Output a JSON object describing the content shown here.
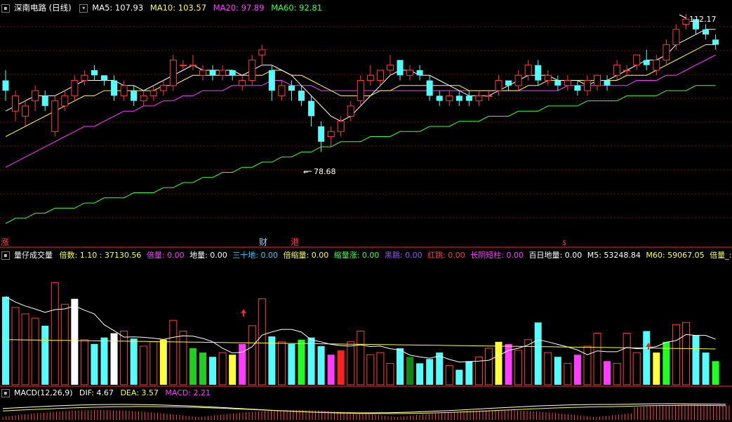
{
  "header": {
    "title": "深南电路 (日线)",
    "ma": [
      {
        "label": "MA5: 107.93",
        "color": "#ffffff"
      },
      {
        "label": "MA10: 103.57",
        "color": "#ffff3c"
      },
      {
        "label": "MA20: 97.89",
        "color": "#ff3cff"
      },
      {
        "label": "MA60: 92.81",
        "color": "#3cff3c"
      }
    ]
  },
  "markers": {
    "zhang": "涨",
    "cai": "财",
    "gang": "港",
    "high_label": "112.17",
    "low_label": "78.68"
  },
  "vol_header": {
    "title": "量仔成交量",
    "items": [
      {
        "label": "倍数: 1.10 : 37130.56",
        "color": "#ffff3c"
      },
      {
        "label": "倍量: 0.00",
        "color": "#ff3cff"
      },
      {
        "label": "地量: 0.00",
        "color": "#ffffff"
      },
      {
        "label": "三十地: 0.00",
        "color": "#3cc8ff"
      },
      {
        "label": "倍缩量: 0.00",
        "color": "#ffff3c"
      },
      {
        "label": "缩量涨: 0.00",
        "color": "#3cff3c"
      },
      {
        "label": "黑跳: 0.00",
        "color": "#9a4cff"
      },
      {
        "label": "红跳: 0.00",
        "color": "#ff3c3c"
      },
      {
        "label": "长阴短柱: 0.00",
        "color": "#ff3cff"
      },
      {
        "label": "百日地量: 0.00",
        "color": "#ffffff"
      },
      {
        "label": "M5: 53248.84",
        "color": "#ffffff"
      },
      {
        "label": "M60: 59067.05",
        "color": "#ffff3c"
      },
      {
        "label": "倍量_:",
        "color": "#ffff3c"
      }
    ]
  },
  "macd_header": {
    "title": "MACD(12,26,9)",
    "items": [
      {
        "label": "DIF: 4.67",
        "color": "#ffffff"
      },
      {
        "label": "DEA: 3.57",
        "color": "#ffff3c"
      },
      {
        "label": "MACD: 2.21",
        "color": "#ff3cff"
      }
    ]
  },
  "colors": {
    "up": "#ff3c3c",
    "down": "#54fcfc",
    "ma5": "#ffffff",
    "ma10": "#ffff3c",
    "ma20": "#ff3cff",
    "ma60": "#3cff3c",
    "grid": "#7a1010"
  },
  "chart_data": {
    "type": "candlestick",
    "price_range": [
      70,
      114
    ],
    "candles": [
      [
        101,
        99,
        103,
        97
      ],
      [
        95,
        98,
        99,
        93
      ],
      [
        94,
        96,
        97,
        92
      ],
      [
        97,
        99,
        100,
        95
      ],
      [
        98,
        96,
        99,
        95
      ],
      [
        91,
        97,
        98,
        90
      ],
      [
        96,
        98,
        99,
        95
      ],
      [
        98,
        101,
        102,
        97
      ],
      [
        101,
        102,
        103,
        100
      ],
      [
        103,
        102,
        104,
        101
      ],
      [
        102,
        101,
        102,
        100
      ],
      [
        101,
        98,
        102,
        97
      ],
      [
        98,
        100,
        101,
        97
      ],
      [
        99,
        97,
        100,
        96
      ],
      [
        97,
        98,
        99,
        96
      ],
      [
        98,
        99,
        100,
        97
      ],
      [
        99,
        100,
        101,
        98
      ],
      [
        100,
        105,
        106,
        99
      ],
      [
        104,
        104,
        105,
        103
      ],
      [
        104,
        104,
        106,
        103
      ],
      [
        102,
        103,
        104,
        101
      ],
      [
        103,
        102,
        104,
        101
      ],
      [
        102,
        103,
        104,
        101
      ],
      [
        103,
        102,
        103,
        101
      ],
      [
        100,
        101,
        102,
        99
      ],
      [
        101,
        105,
        106,
        100
      ],
      [
        106,
        107,
        108,
        104
      ],
      [
        103,
        99,
        104,
        97
      ],
      [
        98,
        100,
        101,
        97
      ],
      [
        100,
        99,
        101,
        97
      ],
      [
        99,
        97,
        100,
        96
      ],
      [
        97,
        94,
        98,
        92
      ],
      [
        92,
        89,
        93,
        87
      ],
      [
        90,
        91,
        92,
        88
      ],
      [
        91,
        93,
        94,
        90
      ],
      [
        94,
        96,
        97,
        93
      ],
      [
        97,
        101,
        102,
        96
      ],
      [
        101,
        102,
        104,
        100
      ],
      [
        101,
        103,
        103,
        100
      ],
      [
        103,
        104,
        106,
        102
      ],
      [
        105,
        102,
        105,
        101
      ],
      [
        102,
        103,
        104,
        101
      ],
      [
        103,
        102,
        104,
        101
      ],
      [
        101,
        98,
        102,
        97
      ],
      [
        98,
        97,
        99,
        96
      ],
      [
        97,
        98,
        99,
        96
      ],
      [
        98,
        97,
        99,
        96
      ],
      [
        98,
        97,
        99,
        96
      ],
      [
        97,
        98,
        99,
        96
      ],
      [
        98,
        98,
        99,
        97
      ],
      [
        99,
        101,
        102,
        98
      ],
      [
        101,
        100,
        101,
        99
      ],
      [
        100,
        102,
        103,
        99
      ],
      [
        102,
        104,
        105,
        101
      ],
      [
        104,
        101,
        105,
        100
      ],
      [
        101,
        102,
        103,
        100
      ],
      [
        101,
        100,
        102,
        99
      ],
      [
        100,
        101,
        102,
        99
      ],
      [
        100,
        99,
        101,
        98
      ],
      [
        99,
        101,
        102,
        98
      ],
      [
        100,
        102,
        102,
        99
      ],
      [
        101,
        100,
        102,
        99
      ],
      [
        102,
        104,
        105,
        101
      ],
      [
        103,
        103,
        104,
        102
      ],
      [
        104,
        106,
        106,
        103
      ],
      [
        105,
        104,
        107,
        103
      ],
      [
        103,
        105,
        106,
        102
      ],
      [
        105,
        108,
        109,
        104
      ],
      [
        108,
        111,
        112,
        107
      ],
      [
        112,
        113,
        114,
        111
      ],
      [
        113,
        111,
        113,
        110
      ],
      [
        111,
        110,
        112,
        109
      ],
      [
        109,
        108,
        110,
        107
      ]
    ],
    "ma5": [
      95,
      96,
      97,
      98,
      98,
      98,
      99,
      100,
      101,
      101,
      101,
      101,
      100,
      100,
      99,
      100,
      101,
      102,
      103,
      104,
      103,
      103,
      103,
      103,
      102,
      103,
      104,
      104,
      103,
      102,
      100,
      98,
      96,
      94,
      93,
      94,
      96,
      98,
      100,
      102,
      103,
      103,
      102,
      102,
      101,
      100,
      99,
      98,
      98,
      98,
      99,
      100,
      101,
      102,
      102,
      102,
      101,
      101,
      101,
      100,
      101,
      101,
      102,
      103,
      104,
      105,
      105,
      106,
      108,
      109,
      110,
      111,
      111
    ],
    "ma10": [
      90,
      91,
      92,
      93,
      94,
      95,
      96,
      97,
      98,
      98,
      99,
      99,
      99,
      99,
      99,
      99,
      100,
      100,
      101,
      102,
      102,
      102,
      102,
      102,
      102,
      102,
      102,
      103,
      103,
      102,
      102,
      101,
      100,
      99,
      98,
      98,
      98,
      98,
      99,
      99,
      100,
      100,
      100,
      100,
      100,
      100,
      100,
      99,
      99,
      99,
      99,
      99,
      99,
      100,
      100,
      101,
      101,
      101,
      101,
      101,
      101,
      101,
      101,
      102,
      102,
      102,
      103,
      104,
      105,
      106,
      107,
      108,
      108
    ],
    "ma20": [
      84,
      85,
      86,
      87,
      88,
      89,
      90,
      91,
      92,
      92,
      93,
      94,
      95,
      95,
      96,
      96,
      97,
      97,
      98,
      98,
      99,
      99,
      99,
      100,
      100,
      100,
      100,
      101,
      101,
      100,
      100,
      100,
      99,
      99,
      99,
      99,
      99,
      99,
      99,
      99,
      99,
      99,
      99,
      99,
      99,
      99,
      99,
      99,
      99,
      99,
      99,
      99,
      99,
      99,
      99,
      99,
      99,
      100,
      100,
      100,
      100,
      100,
      100,
      100,
      101,
      101,
      101,
      102,
      102,
      103,
      104,
      105,
      106
    ],
    "ma60": [
      73,
      74,
      74,
      75,
      75,
      76,
      76,
      76,
      77,
      77,
      78,
      78,
      78,
      79,
      79,
      79,
      80,
      80,
      81,
      81,
      82,
      82,
      83,
      83,
      84,
      84,
      85,
      85,
      86,
      86,
      87,
      87,
      88,
      88,
      89,
      89,
      89,
      90,
      90,
      90,
      91,
      91,
      91,
      92,
      92,
      92,
      93,
      93,
      93,
      94,
      94,
      94,
      95,
      95,
      95,
      96,
      96,
      96,
      96,
      97,
      97,
      97,
      97,
      98,
      98,
      98,
      98,
      99,
      99,
      99,
      100,
      100,
      100
    ]
  }
}
